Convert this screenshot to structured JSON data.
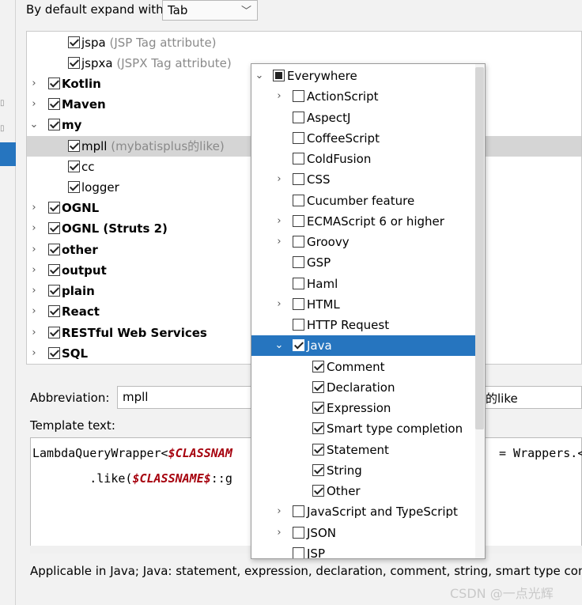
{
  "top": {
    "label": "By default expand with",
    "select_value": "Tab"
  },
  "tree": [
    {
      "label": "jspa",
      "desc": "(JSP Tag attribute)",
      "level": 1,
      "expandable": false,
      "expanded": false,
      "checked": true,
      "bold": false,
      "selected": false
    },
    {
      "label": "jspxa",
      "desc": "(JSPX Tag attribute)",
      "level": 1,
      "expandable": false,
      "expanded": false,
      "checked": true,
      "bold": false,
      "selected": false
    },
    {
      "label": "Kotlin",
      "desc": "",
      "level": 0,
      "expandable": true,
      "expanded": false,
      "checked": true,
      "bold": true,
      "selected": false
    },
    {
      "label": "Maven",
      "desc": "",
      "level": 0,
      "expandable": true,
      "expanded": false,
      "checked": true,
      "bold": true,
      "selected": false
    },
    {
      "label": "my",
      "desc": "",
      "level": 0,
      "expandable": true,
      "expanded": true,
      "checked": true,
      "bold": true,
      "selected": false
    },
    {
      "label": "mpll",
      "desc": "(mybatisplus的like)",
      "level": 1,
      "expandable": false,
      "expanded": false,
      "checked": true,
      "bold": false,
      "selected": true
    },
    {
      "label": "cc",
      "desc": "",
      "level": 1,
      "expandable": false,
      "expanded": false,
      "checked": true,
      "bold": false,
      "selected": false
    },
    {
      "label": "logger",
      "desc": "",
      "level": 1,
      "expandable": false,
      "expanded": false,
      "checked": true,
      "bold": false,
      "selected": false
    },
    {
      "label": "OGNL",
      "desc": "",
      "level": 0,
      "expandable": true,
      "expanded": false,
      "checked": true,
      "bold": true,
      "selected": false
    },
    {
      "label": "OGNL (Struts 2)",
      "desc": "",
      "level": 0,
      "expandable": true,
      "expanded": false,
      "checked": true,
      "bold": true,
      "selected": false
    },
    {
      "label": "other",
      "desc": "",
      "level": 0,
      "expandable": true,
      "expanded": false,
      "checked": true,
      "bold": true,
      "selected": false
    },
    {
      "label": "output",
      "desc": "",
      "level": 0,
      "expandable": true,
      "expanded": false,
      "checked": true,
      "bold": true,
      "selected": false
    },
    {
      "label": "plain",
      "desc": "",
      "level": 0,
      "expandable": true,
      "expanded": false,
      "checked": true,
      "bold": true,
      "selected": false
    },
    {
      "label": "React",
      "desc": "",
      "level": 0,
      "expandable": true,
      "expanded": false,
      "checked": true,
      "bold": true,
      "selected": false
    },
    {
      "label": "RESTful Web Services",
      "desc": "",
      "level": 0,
      "expandable": true,
      "expanded": false,
      "checked": true,
      "bold": true,
      "selected": false
    },
    {
      "label": "SQL",
      "desc": "",
      "level": 0,
      "expandable": true,
      "expanded": false,
      "checked": true,
      "bold": true,
      "selected": false
    }
  ],
  "abbreviation": {
    "label": "Abbreviation:",
    "value": "mpll",
    "description_tail": "的like"
  },
  "template": {
    "label": "Template text:",
    "line1_prefix": "LambdaQueryWrapper<",
    "line1_var": "$CLASSNAM",
    "line1_suffix": "= Wrappers.<",
    "line1_suffix_var": "$",
    "line2_prefix": "        .like(",
    "line2_var": "$CLASSNAME$",
    "line2_suffix": "::g"
  },
  "applicable_text": "Applicable in Java; Java: statement, expression, declaration, comment, string, smart type comple",
  "watermark": "CSDN @一点光辉",
  "popup": [
    {
      "label": "Everywhere",
      "level": 0,
      "arrow": "down",
      "check": "partial",
      "selected": false
    },
    {
      "label": "ActionScript",
      "level": 1,
      "arrow": "right",
      "check": "off",
      "selected": false
    },
    {
      "label": "AspectJ",
      "level": 1,
      "arrow": "",
      "check": "off",
      "selected": false
    },
    {
      "label": "CoffeeScript",
      "level": 1,
      "arrow": "",
      "check": "off",
      "selected": false
    },
    {
      "label": "ColdFusion",
      "level": 1,
      "arrow": "",
      "check": "off",
      "selected": false
    },
    {
      "label": "CSS",
      "level": 1,
      "arrow": "right",
      "check": "off",
      "selected": false
    },
    {
      "label": "Cucumber feature",
      "level": 1,
      "arrow": "",
      "check": "off",
      "selected": false
    },
    {
      "label": "ECMAScript 6 or higher",
      "level": 1,
      "arrow": "right",
      "check": "off",
      "selected": false
    },
    {
      "label": "Groovy",
      "level": 1,
      "arrow": "right",
      "check": "off",
      "selected": false
    },
    {
      "label": "GSP",
      "level": 1,
      "arrow": "",
      "check": "off",
      "selected": false
    },
    {
      "label": "Haml",
      "level": 1,
      "arrow": "",
      "check": "off",
      "selected": false
    },
    {
      "label": "HTML",
      "level": 1,
      "arrow": "right",
      "check": "off",
      "selected": false
    },
    {
      "label": "HTTP Request",
      "level": 1,
      "arrow": "",
      "check": "off",
      "selected": false
    },
    {
      "label": "Java",
      "level": 1,
      "arrow": "down",
      "check": "on",
      "selected": true
    },
    {
      "label": "Comment",
      "level": 2,
      "arrow": "",
      "check": "on",
      "selected": false
    },
    {
      "label": "Declaration",
      "level": 2,
      "arrow": "",
      "check": "on",
      "selected": false
    },
    {
      "label": "Expression",
      "level": 2,
      "arrow": "",
      "check": "on",
      "selected": false
    },
    {
      "label": "Smart type completion",
      "level": 2,
      "arrow": "",
      "check": "on",
      "selected": false
    },
    {
      "label": "Statement",
      "level": 2,
      "arrow": "",
      "check": "on",
      "selected": false
    },
    {
      "label": "String",
      "level": 2,
      "arrow": "",
      "check": "on",
      "selected": false
    },
    {
      "label": "Other",
      "level": 2,
      "arrow": "",
      "check": "on",
      "selected": false
    },
    {
      "label": "JavaScript and TypeScript",
      "level": 1,
      "arrow": "right",
      "check": "off",
      "selected": false
    },
    {
      "label": "JSON",
      "level": 1,
      "arrow": "right",
      "check": "off",
      "selected": false
    },
    {
      "label": "JSP",
      "level": 1,
      "arrow": "",
      "check": "off",
      "selected": false
    }
  ],
  "colors": {
    "selection": "#2675bf",
    "highlight_row": "#d5d5d5",
    "template_variable": "#a6000d"
  }
}
